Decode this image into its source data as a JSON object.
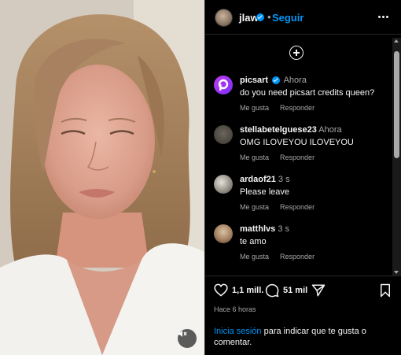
{
  "header": {
    "username": "jlaw",
    "separator": "•",
    "follow_label": "Seguir"
  },
  "comments": [
    {
      "username": "picsart",
      "verified": true,
      "time": "Ahora",
      "text": "do you need picsart credits queen?",
      "like_label": "Me gusta",
      "reply_label": "Responder",
      "avatar_icon": "picsart-logo-icon"
    },
    {
      "username": "stellabetelguese23",
      "verified": false,
      "time": "Ahora",
      "text": "OMG ILOVEYOU ILOVEYOU",
      "like_label": "Me gusta",
      "reply_label": "Responder",
      "avatar_icon": "default-avatar-icon"
    },
    {
      "username": "ardaof21",
      "verified": false,
      "time": "3 s",
      "text": "Please leave",
      "like_label": "Me gusta",
      "reply_label": "Responder",
      "avatar_icon": "avatar-photo-icon"
    },
    {
      "username": "matthlvs",
      "verified": false,
      "time": "3 s",
      "text": "te amo",
      "like_label": "Me gusta",
      "reply_label": "Responder",
      "avatar_icon": "avatar-photo-icon"
    }
  ],
  "actions": {
    "likes": "1,1 mill.",
    "comments": "51 mil"
  },
  "time_ago": "Hace 6 horas",
  "login_prompt": {
    "link": "Inicia sesión",
    "text": " para indicar que te gusta o comentar."
  },
  "colors": {
    "accent": "#0095f6",
    "background": "#000000",
    "text": "#f5f5f5",
    "muted": "#a8a8a8",
    "picsart": "#a13bf2"
  }
}
